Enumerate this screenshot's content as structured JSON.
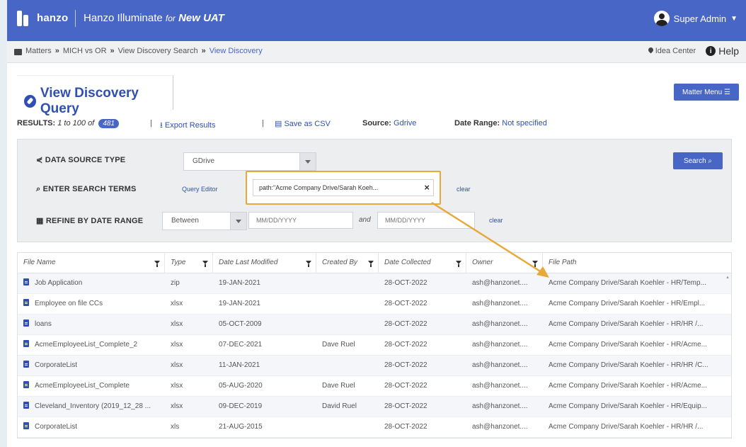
{
  "header": {
    "brand": "hanzo",
    "app_name": "Hanzo Illuminate",
    "for_text": "for",
    "env": "New UAT",
    "user": "Super Admin"
  },
  "breadcrumb": {
    "items": [
      "Matters",
      "MICH vs OR",
      "View Discovery Search",
      "View Discovery"
    ],
    "idea_center": "Idea Center",
    "help": "Help"
  },
  "page": {
    "title": "View Discovery Query",
    "matter_menu": "Matter Menu ☰"
  },
  "results": {
    "label": "RESULTS:",
    "range": "1 to 100 of",
    "total": "481",
    "export": "Export Results",
    "csv": "Save as CSV",
    "source_label": "Source:",
    "source_value": "Gdrive",
    "date_range_label": "Date Range:",
    "date_range_value": "Not specified"
  },
  "filters": {
    "data_source_label": "DATA SOURCE TYPE",
    "data_source_value": "GDrive",
    "search_label": "ENTER SEARCH TERMS",
    "query_editor": "Query Editor",
    "search_value": "path:\"Acme Company Drive/Sarah Koeh...",
    "clear": "clear",
    "date_label": "REFINE BY DATE RANGE",
    "date_mode": "Between",
    "date_placeholder": "MM/DD/YYYY",
    "and": "and",
    "search_button": "Search"
  },
  "table": {
    "columns": [
      "File Name",
      "Type",
      "Date Last Modified",
      "Created By",
      "Date Collected",
      "Owner",
      "File Path"
    ],
    "rows": [
      [
        "Job Application",
        "zip",
        "19-JAN-2021",
        "",
        "28-OCT-2022",
        "ash@hanzonet....",
        "Acme Company Drive/Sarah Koehler - HR/Temp..."
      ],
      [
        "Employee on file CCs",
        "xlsx",
        "19-JAN-2021",
        "",
        "28-OCT-2022",
        "ash@hanzonet....",
        "Acme Company Drive/Sarah Koehler - HR/Empl..."
      ],
      [
        "loans",
        "xlsx",
        "05-OCT-2009",
        "",
        "28-OCT-2022",
        "ash@hanzonet....",
        "Acme Company Drive/Sarah Koehler - HR/HR /..."
      ],
      [
        "AcmeEmployeeList_Complete_2",
        "xlsx",
        "07-DEC-2021",
        "Dave Ruel",
        "28-OCT-2022",
        "ash@hanzonet....",
        "Acme Company Drive/Sarah Koehler - HR/Acme..."
      ],
      [
        "CorporateList",
        "xlsx",
        "11-JAN-2021",
        "",
        "28-OCT-2022",
        "ash@hanzonet....",
        "Acme Company Drive/Sarah Koehler - HR/HR /C..."
      ],
      [
        "AcmeEmployeeList_Complete",
        "xlsx",
        "05-AUG-2020",
        "Dave Ruel",
        "28-OCT-2022",
        "ash@hanzonet....",
        "Acme Company Drive/Sarah Koehler - HR/Acme..."
      ],
      [
        "Cleveland_Inventory (2019_12_28 ...",
        "xlsx",
        "09-DEC-2019",
        "David Ruel",
        "28-OCT-2022",
        "ash@hanzonet....",
        "Acme Company Drive/Sarah Koehler - HR/Equip..."
      ],
      [
        "CorporateList",
        "xls",
        "21-AUG-2015",
        "",
        "28-OCT-2022",
        "ash@hanzonet....",
        "Acme Company Drive/Sarah Koehler - HR/HR /..."
      ]
    ]
  },
  "colors": {
    "header_bg": "#4766c6",
    "link": "#2f4fb3",
    "highlight": "#e8a93a"
  }
}
